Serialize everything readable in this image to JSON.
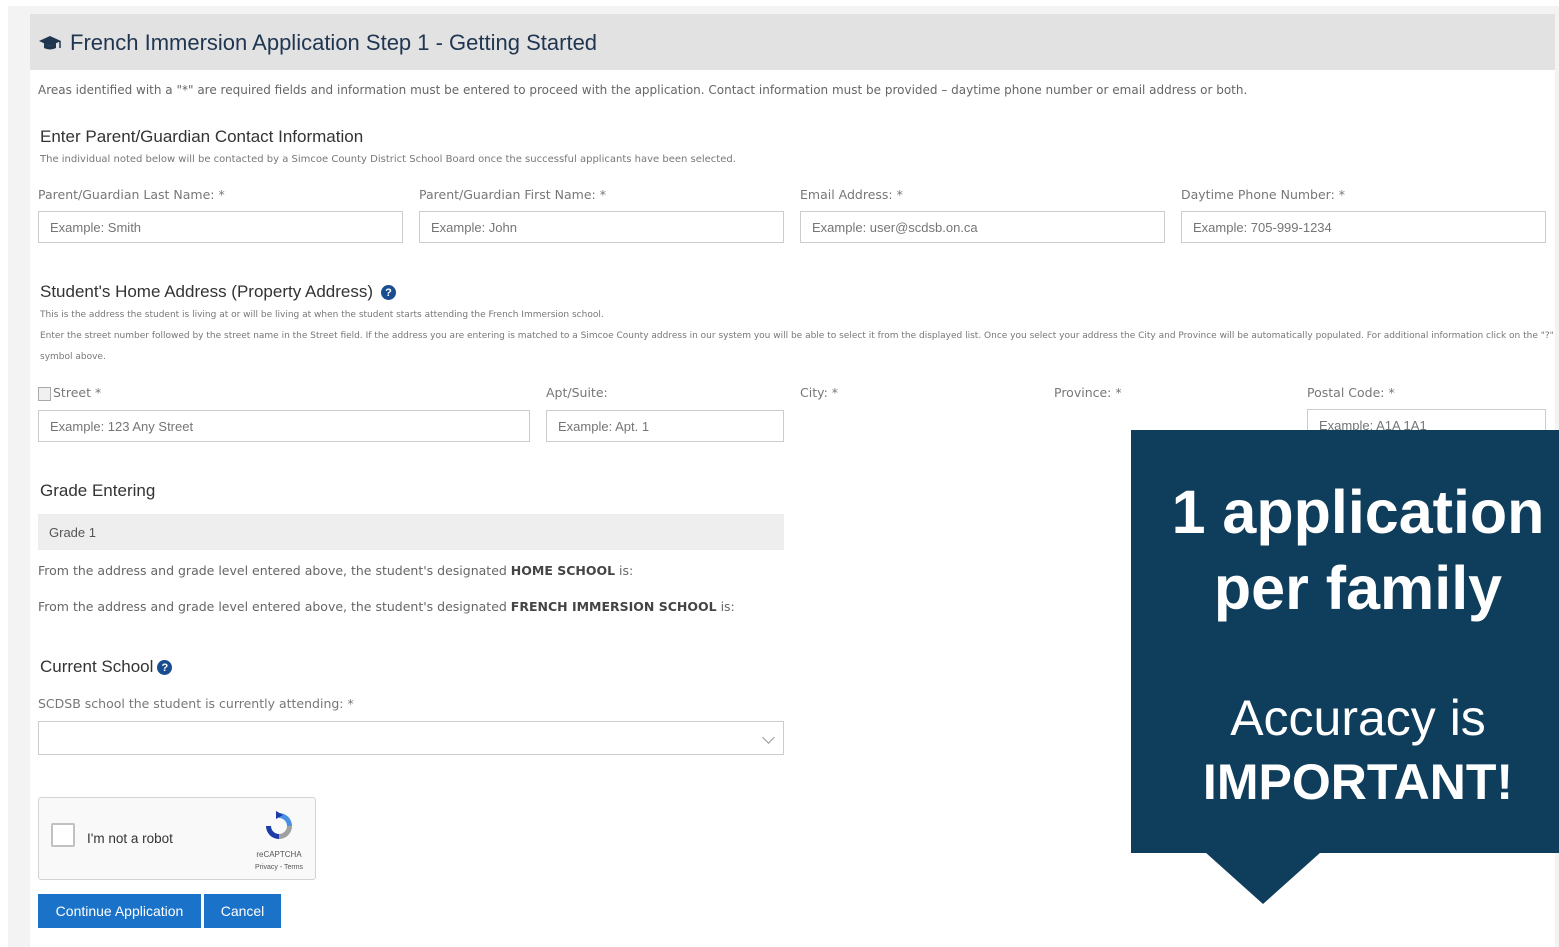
{
  "header": {
    "title": "French Immersion Application Step 1 - Getting Started",
    "icon": "graduation-cap-icon"
  },
  "required_note": "Areas identified with a \"*\" are required fields and information must be entered to proceed with the application. Contact information must be provided – daytime phone number or email address or both.",
  "contact": {
    "heading": "Enter Parent/Guardian Contact Information",
    "subtext": "The individual noted below will be contacted by a Simcoe County District School Board once the successful applicants have been selected.",
    "last_name": {
      "label": "Parent/Guardian Last Name: *",
      "placeholder": "Example: Smith"
    },
    "first_name": {
      "label": "Parent/Guardian First Name: *",
      "placeholder": "Example: John"
    },
    "email": {
      "label": "Email Address: *",
      "placeholder": "Example: user@scdsb.on.ca"
    },
    "phone": {
      "label": "Daytime Phone Number: *",
      "placeholder": "Example: 705-999-1234"
    }
  },
  "address": {
    "heading": "Student's Home Address (Property Address)",
    "help_icon": "?",
    "subtext1": "This is the address the student is living at or will be living at when the student starts attending the French Immersion school.",
    "subtext2": "Enter the street number followed by the street name in the Street field. If the address you are entering is matched to a Simcoe County address in our system you will be able to select it from the displayed list. Once you select your address the City and Province will be automatically populated. For additional information click on the \"?\"",
    "subtext3": "symbol above.",
    "street": {
      "label": "Street *",
      "placeholder": "Example: 123 Any Street"
    },
    "apt": {
      "label": "Apt/Suite:",
      "placeholder": "Example: Apt. 1"
    },
    "city": {
      "label": "City: *"
    },
    "province": {
      "label": "Province: *"
    },
    "postal": {
      "label": "Postal Code: *",
      "placeholder": "Example: A1A 1A1"
    }
  },
  "grade": {
    "heading": "Grade Entering",
    "value": "Grade 1",
    "home_prefix": "From the address and grade level entered above, the student's designated ",
    "home_bold": "HOME SCHOOL",
    "home_suffix": " is:",
    "fi_prefix": "From the address and grade level entered above, the student's designated ",
    "fi_bold": "FRENCH IMMERSION SCHOOL",
    "fi_suffix": " is:"
  },
  "current_school": {
    "heading": "Current School",
    "help_icon": "?",
    "label": "SCDSB school the student is currently attending: *",
    "value": ""
  },
  "recaptcha": {
    "label": "I'm not a robot",
    "brand": "reCAPTCHA",
    "links": "Privacy - Terms"
  },
  "buttons": {
    "continue": "Continue Application",
    "cancel": "Cancel"
  },
  "callout": {
    "line1": "1 application",
    "line2": "per family",
    "line3": "Accuracy is",
    "line4": "IMPORTANT!"
  },
  "colors": {
    "accent": "#1a73c9",
    "callout_bg": "#0f3d5c",
    "title": "#1f3550"
  }
}
